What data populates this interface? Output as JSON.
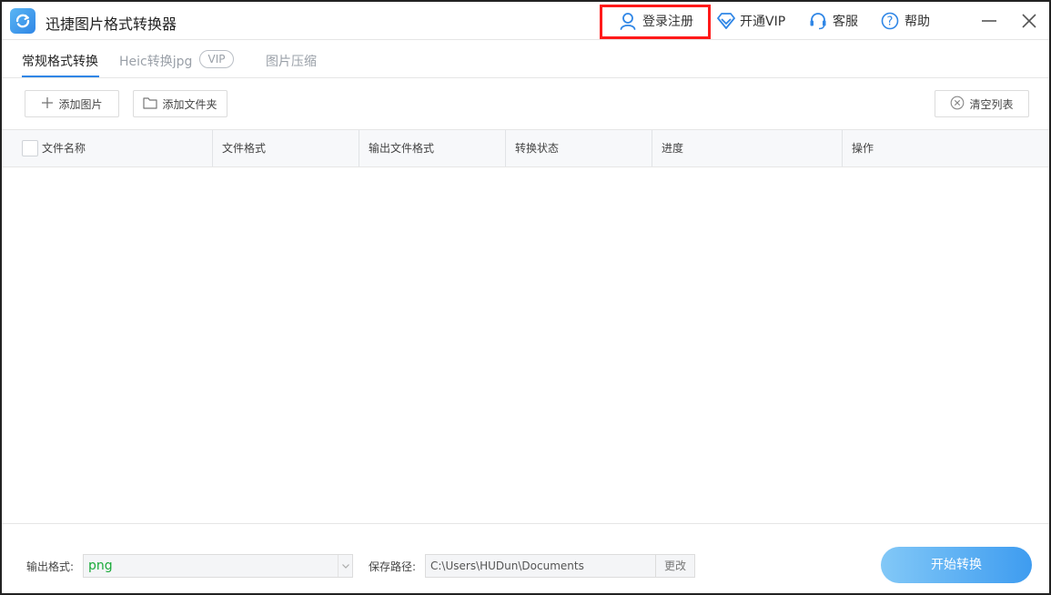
{
  "app": {
    "title": "迅捷图片格式转换器",
    "accent_color": "#2f86e6",
    "highlight_color": "#ff1a1a"
  },
  "titlebar": {
    "login_label": "登录注册",
    "vip_label": "开通VIP",
    "service_label": "客服",
    "help_label": "帮助",
    "icons": [
      "user-icon",
      "diamond-icon",
      "headset-icon",
      "help-icon",
      "minimize-icon",
      "close-icon"
    ]
  },
  "tabs": {
    "items": [
      {
        "label": "常规格式转换",
        "active": true
      },
      {
        "label": "Heic转换jpg",
        "badge": "VIP",
        "active": false
      },
      {
        "label": "图片压缩",
        "active": false
      }
    ]
  },
  "toolbar": {
    "add_image_label": "添加图片",
    "add_folder_label": "添加文件夹",
    "clear_list_label": "清空列表"
  },
  "table": {
    "columns": [
      "文件名称",
      "文件格式",
      "输出文件格式",
      "转换状态",
      "进度",
      "操作"
    ],
    "rows": []
  },
  "footer": {
    "output_format_label": "输出格式:",
    "output_format_value": "png",
    "save_path_label": "保存路径:",
    "save_path_value": "C:\\Users\\HUDun\\Documents",
    "change_label": "更改",
    "start_label": "开始转换"
  }
}
